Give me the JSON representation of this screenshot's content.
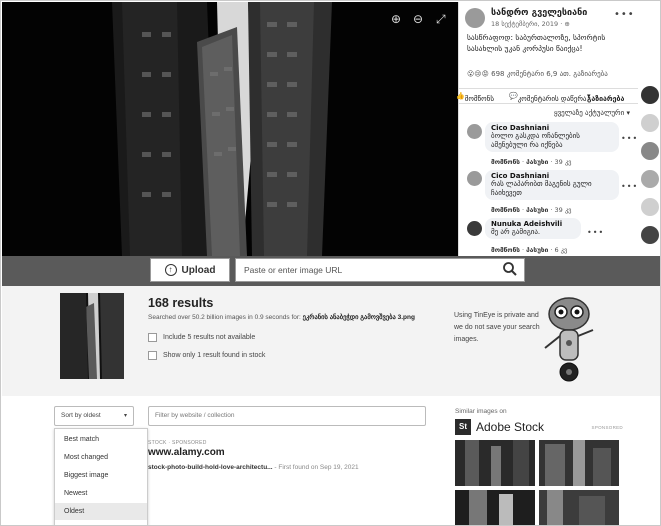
{
  "facebook": {
    "poster_name": "სანდრო გველესიანი",
    "post_date": "18 სექტემბერი, 2019 · ",
    "post_text": "სასწრაფოდ: საბურთალოზე, სპორტის სასახლის უკან კორპუსი წაიქცა!",
    "reactions_summary": "698 კომენტარი 6,9 ათ. გაზიარება",
    "action_like": "მომწონს",
    "action_comment": "კომენტარის დაწერა",
    "action_share": "გაზიარება",
    "comment_sort": "ყველაზე აქტუალური",
    "comments": [
      {
        "name": "Cico Dashniani",
        "text": "ბოლო გასკდა ოჩანლების ამენებული რა იქნება",
        "meta": "· 39 კვ"
      },
      {
        "name": "Cico Dashniani",
        "text": "რას ლაპარიბთ მაგენის გული ჩაიხევეთ",
        "meta": "· 39 კვ"
      },
      {
        "name": "Nunuka Adeishvili",
        "text": "მე არ გამიგია.",
        "meta": "· 6 კვ"
      }
    ],
    "comment_like": "მომწონს",
    "comment_reply": "პასუხი"
  },
  "tineye": {
    "upload_label": "Upload",
    "url_placeholder": "Paste or enter image URL",
    "results_count": "168 results",
    "searched_prefix": "Searched over 50.2 billion images in 0.9 seconds for: ",
    "searched_file": "ეკრანის ანაბეჭდი გამოვშვება 3.png",
    "include_label": "Include 5 results not available",
    "stock_only_label": "Show only 1 result found in stock",
    "private_note": "Using TinEye is private and we do not save your search images.",
    "sort_selected": "Sort by oldest",
    "filter_placeholder": "Filter by website / collection",
    "sort_options": [
      "Best match",
      "Most changed",
      "Biggest image",
      "Newest",
      "Oldest"
    ],
    "result_tag": "STOCK · SPONSORED",
    "result_site": "www.alamy.com",
    "result_file": "stock-photo-build-hold-love-architectu...",
    "result_found": " - First found on Sep 19, 2021",
    "similar_title": "Similar images on",
    "adobe_logo": "St",
    "adobe_name": "Adobe Stock",
    "sponsored": "SPONSORED"
  },
  "colors": {
    "header_bar": "#5a5a5a",
    "summary_bg": "#f3f3f3",
    "selected_option_bg": "#e9e9e9"
  }
}
